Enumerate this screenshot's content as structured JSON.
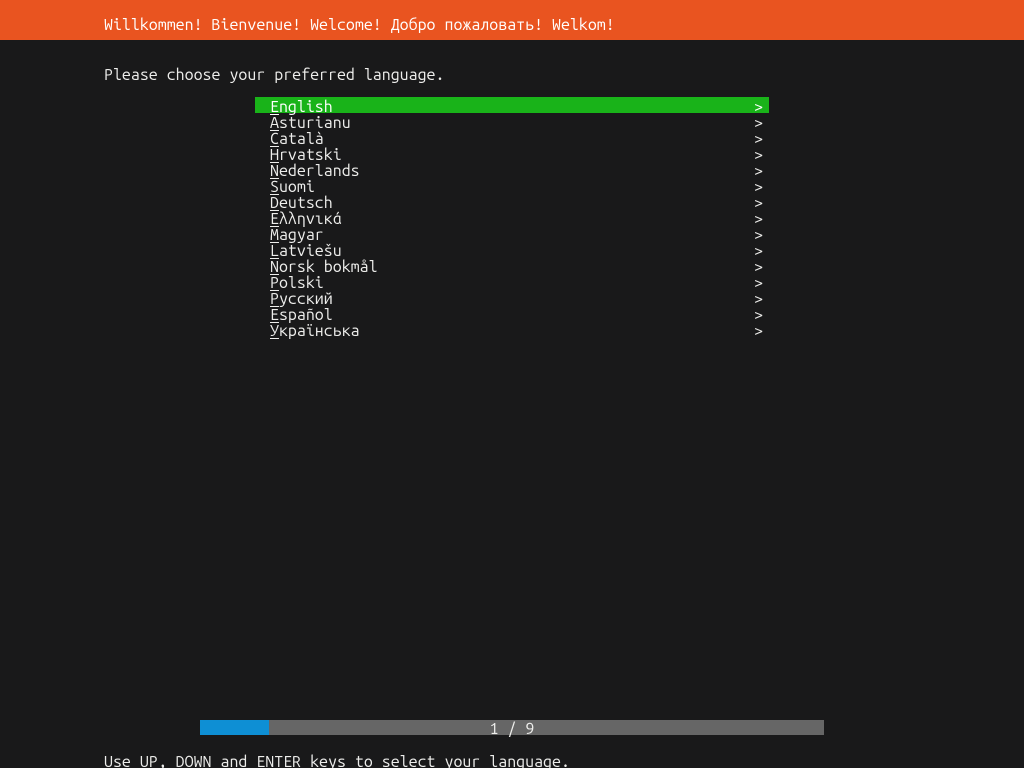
{
  "header": {
    "title": "Willkommen! Bienvenue! Welcome! Добро пожаловать! Welkom!"
  },
  "prompt": "Please choose your preferred language.",
  "languages": [
    {
      "label": "English",
      "selected": true
    },
    {
      "label": "Asturianu",
      "selected": false
    },
    {
      "label": "Català",
      "selected": false
    },
    {
      "label": "Hrvatski",
      "selected": false
    },
    {
      "label": "Nederlands",
      "selected": false
    },
    {
      "label": "Suomi",
      "selected": false
    },
    {
      "label": "Deutsch",
      "selected": false
    },
    {
      "label": "Ελληνικά",
      "selected": false
    },
    {
      "label": "Magyar",
      "selected": false
    },
    {
      "label": "Latviešu",
      "selected": false
    },
    {
      "label": "Norsk bokmål",
      "selected": false
    },
    {
      "label": "Polski",
      "selected": false
    },
    {
      "label": "Русский",
      "selected": false
    },
    {
      "label": "Español",
      "selected": false
    },
    {
      "label": "Українська",
      "selected": false
    }
  ],
  "arrow_glyph": ">",
  "progress": {
    "current": 1,
    "total": 9,
    "label": "1 / 9",
    "fill_percent": 11.1
  },
  "footer": {
    "hint": "Use UP, DOWN and ENTER keys to select your language."
  },
  "colors": {
    "header_bg": "#e95420",
    "selection_bg": "#19b319",
    "progress_fill": "#0e8fd4",
    "progress_track": "#666666",
    "page_bg": "#19191a",
    "text": "#eeeeec"
  }
}
